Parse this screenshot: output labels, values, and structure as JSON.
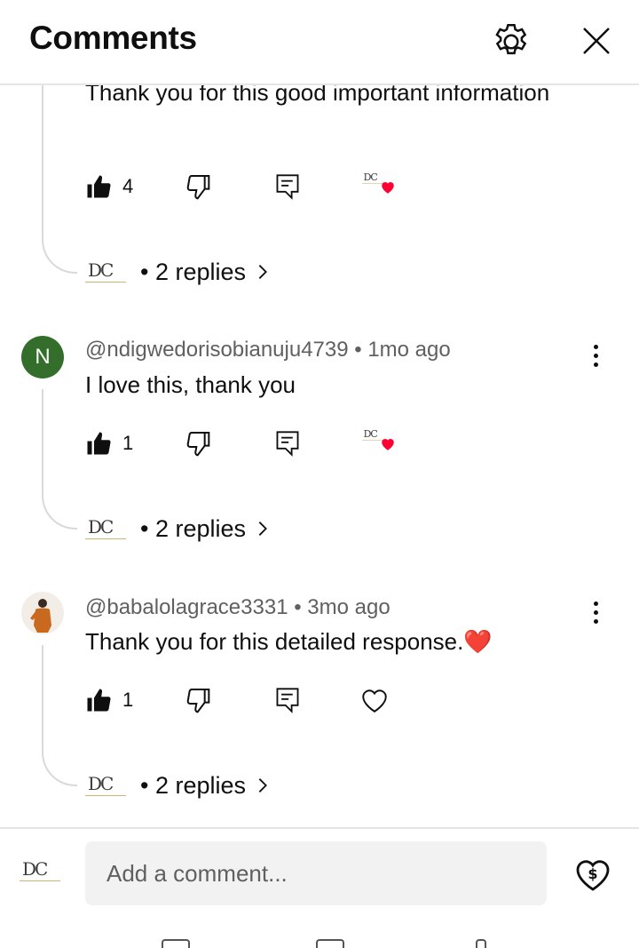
{
  "header": {
    "title": "Comments"
  },
  "comments": [
    {
      "author": "",
      "age": "",
      "text": "Thank you for this good important information",
      "likes": "4",
      "hearted": true,
      "replies": "• 2 replies"
    },
    {
      "avatar_letter": "N",
      "avatar_color": "#336f2a",
      "author": "@ndigwedorisobianuju4739 • 1mo ago",
      "text": "I love this, thank you",
      "likes": "1",
      "hearted": true,
      "replies": "• 2 replies"
    },
    {
      "author": "@babalolagrace3331 • 3mo ago",
      "text": "Thank you for this detailed response.❤️",
      "likes": "1",
      "hearted": false,
      "replies": "• 2 replies"
    }
  ],
  "logo_text": "DC",
  "footer": {
    "placeholder": "Add a comment..."
  },
  "colors": {
    "heart": "#ff0033",
    "avatar_green": "#336f2a",
    "divider": "#e5e5e5"
  }
}
